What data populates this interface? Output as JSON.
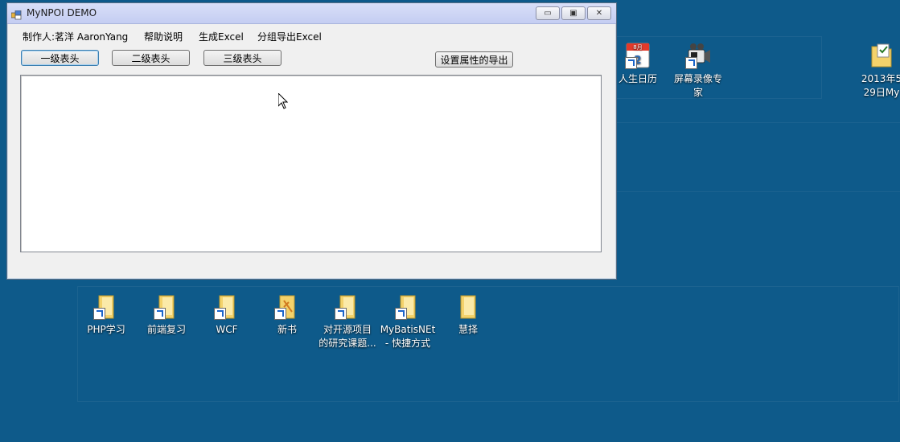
{
  "window": {
    "title": "MyNPOI DEMO",
    "caption_buttons": {
      "minimize": "▭",
      "maximize": "▣",
      "close": "✕"
    }
  },
  "menu": [
    {
      "label": "制作人:茗洋 AaronYang"
    },
    {
      "label": "帮助说明"
    },
    {
      "label": "生成Excel"
    },
    {
      "label": "分组导出Excel"
    }
  ],
  "buttons": {
    "level1": "一级表头",
    "level2": "二级表头",
    "level3": "三级表头",
    "export_props": "设置属性的导出"
  },
  "desktop_icons": {
    "calendar": {
      "label": "人生日历",
      "icon": "calendar-icon",
      "badge": "8月"
    },
    "recorder": {
      "label": "屏幕录像专\n家",
      "icon": "camera-recorder-icon"
    },
    "date_file": {
      "label": "2013年5\n29日My",
      "icon": "document-folder-icon"
    },
    "php": {
      "label": "PHP学习",
      "icon": "folder-icon"
    },
    "frontend": {
      "label": "前端复习",
      "icon": "folder-icon"
    },
    "wcf": {
      "label": "WCF",
      "icon": "folder-icon"
    },
    "newbook": {
      "label": "新书",
      "icon": "folder-icon"
    },
    "opensource": {
      "label": "对开源项目\n的研究课题...",
      "icon": "folder-icon"
    },
    "mybatis": {
      "label": "MyBatisNEt\n- 快捷方式",
      "icon": "folder-icon"
    },
    "huize": {
      "label": "慧择",
      "icon": "folder-icon"
    }
  },
  "colors": {
    "desktop": "#0e5a8a",
    "titlebar": "#c4cdf2",
    "window_face": "#f0f0f0",
    "calendar_red": "#e23a2a",
    "folder_yellow": "#f3d26b"
  }
}
